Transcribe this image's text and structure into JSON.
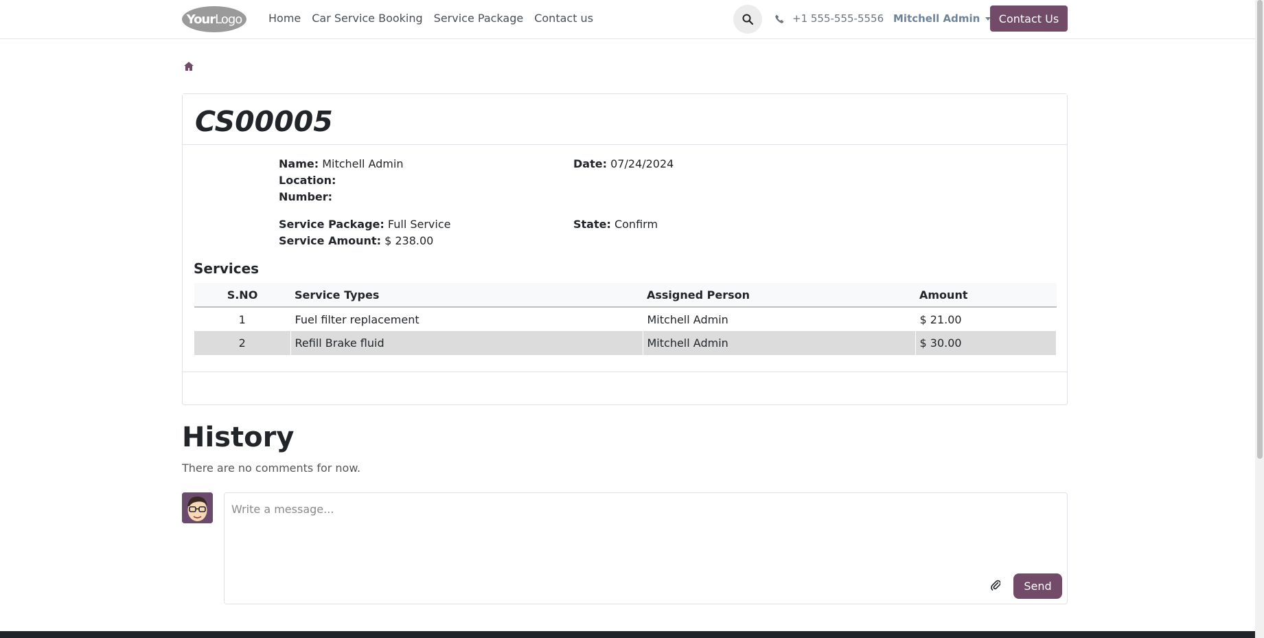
{
  "nav": {
    "logo_a": "Your",
    "logo_b": "Logo",
    "links": [
      "Home",
      "Car Service Booking",
      "Service Package",
      "Contact us"
    ],
    "phone": "+1 555-555-5556",
    "user": "Mitchell Admin",
    "contact_button": "Contact Us"
  },
  "record": {
    "title": "CS00005",
    "name_label": "Name:",
    "name": "Mitchell Admin",
    "location_label": "Location:",
    "location": "",
    "number_label": "Number:",
    "number": "",
    "date_label": "Date:",
    "date": "07/24/2024",
    "package_label": "Service Package:",
    "package": "Full Service",
    "amount_label": "Service Amount:",
    "amount": "$ 238.00",
    "state_label": "State:",
    "state": "Confirm"
  },
  "services": {
    "title": "Services",
    "headers": [
      "S.NO",
      "Service Types",
      "Assigned Person",
      "Amount"
    ],
    "rows": [
      [
        "1",
        "Fuel filter replacement",
        "Mitchell Admin",
        "$ 21.00"
      ],
      [
        "2",
        "Refill Brake fluid",
        "Mitchell Admin",
        "$ 30.00"
      ]
    ]
  },
  "history": {
    "title": "History",
    "empty": "There are no comments for now.",
    "placeholder": "Write a message...",
    "send": "Send"
  },
  "icons": {
    "search": "search-icon",
    "phone": "phone-icon",
    "home": "home-icon",
    "paperclip": "paperclip-icon"
  },
  "colors": {
    "brand": "#714b67",
    "row_alt": "#dcdcdc"
  }
}
